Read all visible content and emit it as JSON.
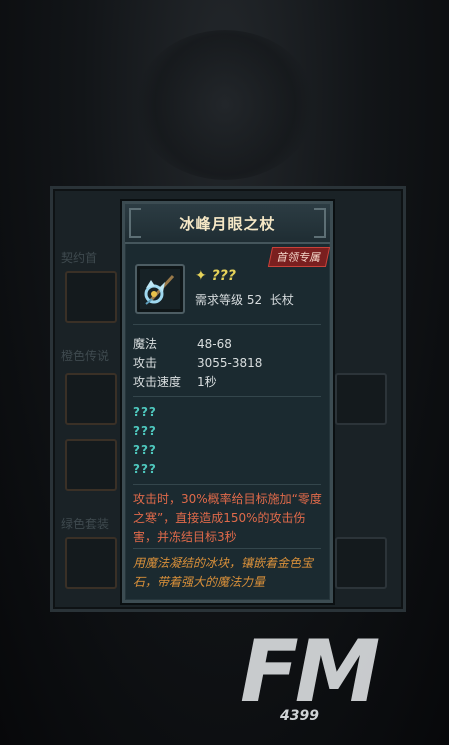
{
  "background": {
    "labels": [
      "契约首",
      "橙色传说",
      "绿色套装"
    ]
  },
  "item": {
    "name": "冰峰月眼之杖",
    "badge": "首领专属",
    "stars": "???",
    "level_req": "需求等级 52",
    "weapon_type": "长杖",
    "stats": [
      {
        "name": "魔法",
        "value": "48-68"
      },
      {
        "name": "攻击",
        "value": "3055-3818"
      },
      {
        "name": "攻击速度",
        "value": "1秒"
      }
    ],
    "unknown_attrs": [
      "???",
      "???",
      "???",
      "???"
    ],
    "effect": "攻击时，30%概率给目标施加“零度之寒”，直接造成150%的攻击伤害，并冻结目标3秒",
    "flavor": "用魔法凝结的冰块，镶嵌着金色宝石，带着强大的魔法力量",
    "icon": "ice-staff-icon"
  },
  "watermark": {
    "main": "FM",
    "sub": "4399"
  },
  "colors": {
    "effect_text": "#e06a4a",
    "flavor_text": "#d9903a",
    "unknown_text": "#4ec7bd",
    "badge_bg": "#7a1f1f"
  }
}
